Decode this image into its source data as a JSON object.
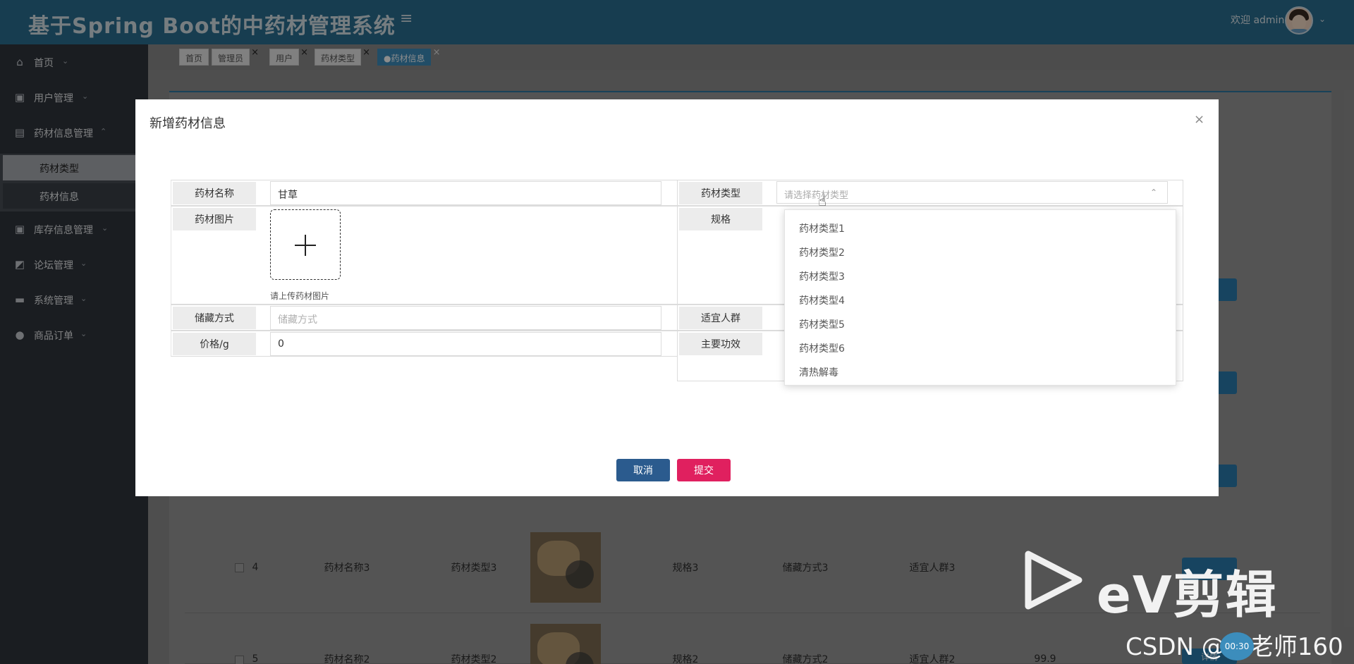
{
  "app": {
    "title": "基于Spring Boot的中药材管理系统",
    "welcome": "欢迎 admin"
  },
  "sidebar": {
    "items": [
      {
        "label": "首页",
        "icon": "home-icon"
      },
      {
        "label": "用户管理",
        "icon": "chip-icon"
      },
      {
        "label": "药材信息管理",
        "icon": "table-icon"
      },
      {
        "label": "库存信息管理",
        "icon": "chip-icon"
      },
      {
        "label": "论坛管理",
        "icon": "chart-icon"
      },
      {
        "label": "系统管理",
        "icon": "window-icon"
      },
      {
        "label": "商品订单",
        "icon": "circle-info-icon"
      }
    ],
    "sub_items": [
      {
        "label": "药材类型"
      },
      {
        "label": "药材信息"
      }
    ]
  },
  "tabs": [
    {
      "label": "首页"
    },
    {
      "label": "管理员"
    },
    {
      "label": "用户"
    },
    {
      "label": "药材类型"
    },
    {
      "label": "●药材信息"
    }
  ],
  "table_bg": {
    "rows": [
      {
        "index": "4",
        "name": "药材名称3",
        "type": "药材类型3",
        "spec": "规格3",
        "storage": "储藏方式3",
        "crowd": "适宜人群3"
      },
      {
        "index": "5",
        "name": "药材名称2",
        "type": "药材类型2",
        "spec": "规格2",
        "storage": "储藏方式2",
        "crowd": "适宜人群2",
        "price": "99.9"
      }
    ],
    "detail_label": "详情"
  },
  "modal": {
    "title": "新增药材信息",
    "fields": {
      "name_label": "药材名称",
      "name_value": "甘草",
      "type_label": "药材类型",
      "type_placeholder": "请选择药材类型",
      "image_label": "药材图片",
      "upload_tip": "请上传药材图片",
      "spec_label": "规格",
      "storage_label": "储藏方式",
      "storage_placeholder": "储藏方式",
      "crowd_label": "适宜人群",
      "price_label": "价格/g",
      "price_value": "0",
      "effect_label": "主要功效"
    },
    "cancel": "取消",
    "submit": "提交"
  },
  "dropdown": {
    "options": [
      "药材类型1",
      "药材类型2",
      "药材类型3",
      "药材类型4",
      "药材类型5",
      "药材类型6",
      "清热解毒"
    ]
  },
  "watermark": {
    "brand": "eV剪辑",
    "csdn": "CSDN @王老师160",
    "timer": "00:30"
  },
  "colors": {
    "header": "#2b6f93",
    "sidebar": "#30353d",
    "submit": "#e0205f",
    "cancel": "#2b5b8e",
    "active_tab": "#3c8dbc"
  }
}
